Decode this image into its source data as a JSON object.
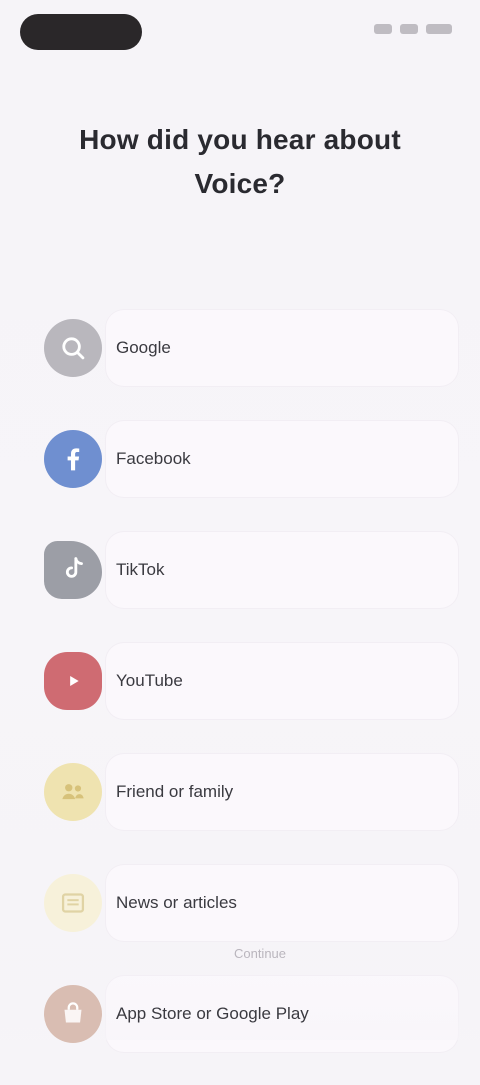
{
  "header": {
    "title": "How did you hear about Voice?"
  },
  "options": [
    {
      "label": "Google",
      "icon": "search-icon",
      "color": "#b9b7bd"
    },
    {
      "label": "Facebook",
      "icon": "facebook-icon",
      "color": "#6f8fd0"
    },
    {
      "label": "TikTok",
      "icon": "tiktok-icon",
      "color": "#9c9ea6"
    },
    {
      "label": "YouTube",
      "icon": "youtube-icon",
      "color": "#cf6b72"
    },
    {
      "label": "Friend or family",
      "icon": "people-icon",
      "color": "#efe3b0"
    },
    {
      "label": "News or articles",
      "icon": "newspaper-icon",
      "color": "#f7f1da"
    },
    {
      "label": "App Store or Google Play",
      "icon": "store-icon",
      "color": "#d9bdb2"
    }
  ],
  "divider": {
    "label": "Continue"
  }
}
